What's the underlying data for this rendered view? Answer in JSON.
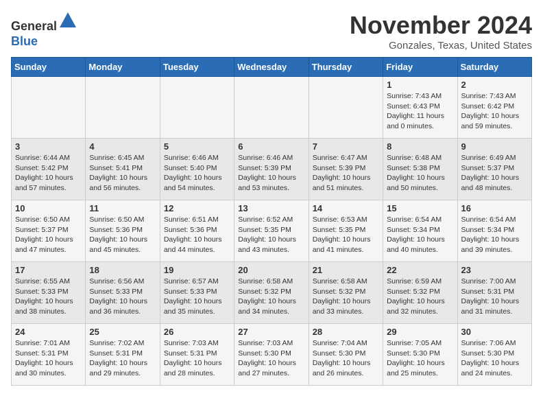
{
  "logo": {
    "general": "General",
    "blue": "Blue"
  },
  "title": "November 2024",
  "subtitle": "Gonzales, Texas, United States",
  "days_of_week": [
    "Sunday",
    "Monday",
    "Tuesday",
    "Wednesday",
    "Thursday",
    "Friday",
    "Saturday"
  ],
  "weeks": [
    [
      {
        "day": "",
        "info": ""
      },
      {
        "day": "",
        "info": ""
      },
      {
        "day": "",
        "info": ""
      },
      {
        "day": "",
        "info": ""
      },
      {
        "day": "",
        "info": ""
      },
      {
        "day": "1",
        "info": "Sunrise: 7:43 AM\nSunset: 6:43 PM\nDaylight: 11 hours and 0 minutes."
      },
      {
        "day": "2",
        "info": "Sunrise: 7:43 AM\nSunset: 6:42 PM\nDaylight: 10 hours and 59 minutes."
      }
    ],
    [
      {
        "day": "3",
        "info": "Sunrise: 6:44 AM\nSunset: 5:42 PM\nDaylight: 10 hours and 57 minutes."
      },
      {
        "day": "4",
        "info": "Sunrise: 6:45 AM\nSunset: 5:41 PM\nDaylight: 10 hours and 56 minutes."
      },
      {
        "day": "5",
        "info": "Sunrise: 6:46 AM\nSunset: 5:40 PM\nDaylight: 10 hours and 54 minutes."
      },
      {
        "day": "6",
        "info": "Sunrise: 6:46 AM\nSunset: 5:39 PM\nDaylight: 10 hours and 53 minutes."
      },
      {
        "day": "7",
        "info": "Sunrise: 6:47 AM\nSunset: 5:39 PM\nDaylight: 10 hours and 51 minutes."
      },
      {
        "day": "8",
        "info": "Sunrise: 6:48 AM\nSunset: 5:38 PM\nDaylight: 10 hours and 50 minutes."
      },
      {
        "day": "9",
        "info": "Sunrise: 6:49 AM\nSunset: 5:37 PM\nDaylight: 10 hours and 48 minutes."
      }
    ],
    [
      {
        "day": "10",
        "info": "Sunrise: 6:50 AM\nSunset: 5:37 PM\nDaylight: 10 hours and 47 minutes."
      },
      {
        "day": "11",
        "info": "Sunrise: 6:50 AM\nSunset: 5:36 PM\nDaylight: 10 hours and 45 minutes."
      },
      {
        "day": "12",
        "info": "Sunrise: 6:51 AM\nSunset: 5:36 PM\nDaylight: 10 hours and 44 minutes."
      },
      {
        "day": "13",
        "info": "Sunrise: 6:52 AM\nSunset: 5:35 PM\nDaylight: 10 hours and 43 minutes."
      },
      {
        "day": "14",
        "info": "Sunrise: 6:53 AM\nSunset: 5:35 PM\nDaylight: 10 hours and 41 minutes."
      },
      {
        "day": "15",
        "info": "Sunrise: 6:54 AM\nSunset: 5:34 PM\nDaylight: 10 hours and 40 minutes."
      },
      {
        "day": "16",
        "info": "Sunrise: 6:54 AM\nSunset: 5:34 PM\nDaylight: 10 hours and 39 minutes."
      }
    ],
    [
      {
        "day": "17",
        "info": "Sunrise: 6:55 AM\nSunset: 5:33 PM\nDaylight: 10 hours and 38 minutes."
      },
      {
        "day": "18",
        "info": "Sunrise: 6:56 AM\nSunset: 5:33 PM\nDaylight: 10 hours and 36 minutes."
      },
      {
        "day": "19",
        "info": "Sunrise: 6:57 AM\nSunset: 5:33 PM\nDaylight: 10 hours and 35 minutes."
      },
      {
        "day": "20",
        "info": "Sunrise: 6:58 AM\nSunset: 5:32 PM\nDaylight: 10 hours and 34 minutes."
      },
      {
        "day": "21",
        "info": "Sunrise: 6:58 AM\nSunset: 5:32 PM\nDaylight: 10 hours and 33 minutes."
      },
      {
        "day": "22",
        "info": "Sunrise: 6:59 AM\nSunset: 5:32 PM\nDaylight: 10 hours and 32 minutes."
      },
      {
        "day": "23",
        "info": "Sunrise: 7:00 AM\nSunset: 5:31 PM\nDaylight: 10 hours and 31 minutes."
      }
    ],
    [
      {
        "day": "24",
        "info": "Sunrise: 7:01 AM\nSunset: 5:31 PM\nDaylight: 10 hours and 30 minutes."
      },
      {
        "day": "25",
        "info": "Sunrise: 7:02 AM\nSunset: 5:31 PM\nDaylight: 10 hours and 29 minutes."
      },
      {
        "day": "26",
        "info": "Sunrise: 7:03 AM\nSunset: 5:31 PM\nDaylight: 10 hours and 28 minutes."
      },
      {
        "day": "27",
        "info": "Sunrise: 7:03 AM\nSunset: 5:30 PM\nDaylight: 10 hours and 27 minutes."
      },
      {
        "day": "28",
        "info": "Sunrise: 7:04 AM\nSunset: 5:30 PM\nDaylight: 10 hours and 26 minutes."
      },
      {
        "day": "29",
        "info": "Sunrise: 7:05 AM\nSunset: 5:30 PM\nDaylight: 10 hours and 25 minutes."
      },
      {
        "day": "30",
        "info": "Sunrise: 7:06 AM\nSunset: 5:30 PM\nDaylight: 10 hours and 24 minutes."
      }
    ]
  ]
}
